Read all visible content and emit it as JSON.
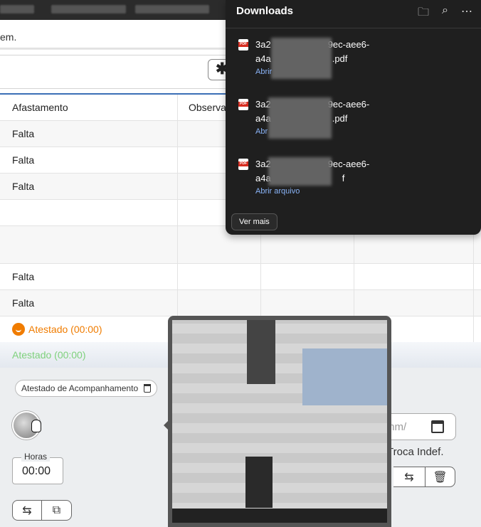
{
  "page": {
    "address_fragment": "em."
  },
  "toolbar": {
    "asterisk_label": "✱"
  },
  "table": {
    "headers": [
      "Afastamento",
      "Observa"
    ],
    "rows": [
      {
        "c1": "Falta"
      },
      {
        "c1": "Falta"
      },
      {
        "c1": "Falta"
      },
      {
        "c1": ""
      },
      {
        "c1": ""
      },
      {
        "c1": "Falta"
      },
      {
        "c1": "Falta"
      },
      {
        "c1": "Atestado (00:00)"
      }
    ],
    "selected_row": "Atestado (00:00)"
  },
  "detail": {
    "chip_label": "Atestado de Acompanhamento",
    "hours_label": "Horas",
    "hours_value": "00:00",
    "date_placeholder": "mm/",
    "troca_label": "Troca Indef."
  },
  "downloads": {
    "title": "Downloads",
    "items": [
      {
        "name_line1": "3a2",
        "name_line1_end": "9ec-aee6-",
        "name_line2": "a4a",
        "name_line2_end": ".pdf",
        "action": "Abrir"
      },
      {
        "name_line1": "3a2",
        "name_line1_end": "9ec-aee6-",
        "name_line2": "a4a",
        "name_line2_end": ".pdf",
        "action": "Abr"
      },
      {
        "name_line1": "3a2",
        "name_line1_end": "9ec-aee6-",
        "name_line2": "a4a",
        "name_line2_end": "f",
        "action": "Abrir arquivo"
      }
    ],
    "more_label": "Ver mais"
  },
  "colors": {
    "accent_blue": "#3b6fb6",
    "warning_orange": "#f07c00",
    "success_green": "#7ed17c",
    "download_link": "#8ab4f8"
  }
}
